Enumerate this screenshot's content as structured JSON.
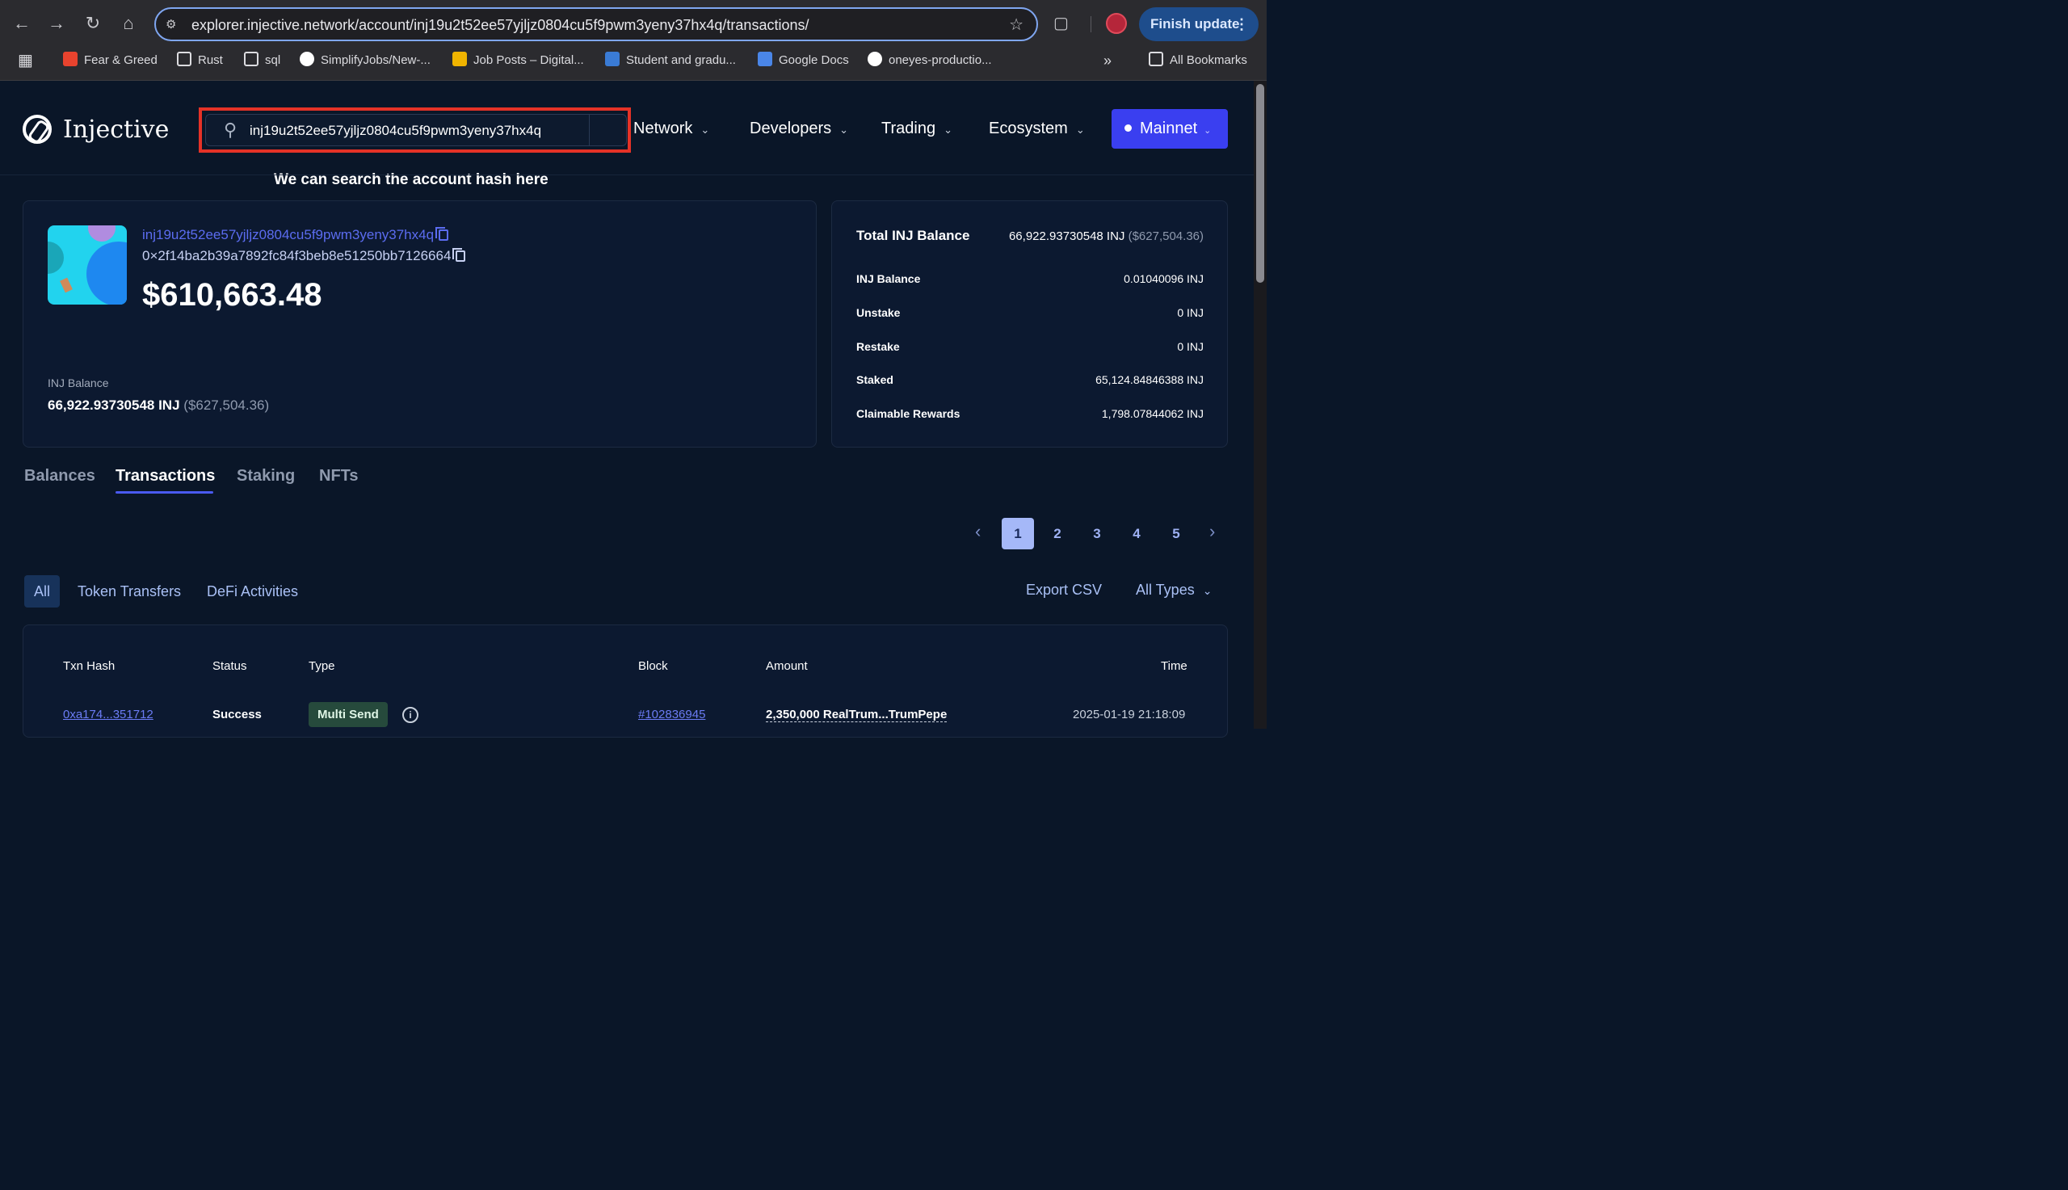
{
  "browser": {
    "url": "explorer.injective.network/account/inj19u2t52ee57yjljz0804cu5f9pwm3yeny37hx4q/transactions/",
    "finish_update": "Finish update",
    "bookmarks": [
      {
        "label": "Fear & Greed",
        "icon": "letter-a-icon",
        "color": "#e8432e"
      },
      {
        "label": "Rust",
        "icon": "folder-icon"
      },
      {
        "label": "sql",
        "icon": "folder-icon"
      },
      {
        "label": "SimplifyJobs/New-...",
        "icon": "github-icon"
      },
      {
        "label": "Job Posts – Digital...",
        "icon": "arrow-logo-icon",
        "color": "#f0b400"
      },
      {
        "label": "Student and gradu...",
        "icon": "nscc-icon",
        "color": "#3a7bd5"
      },
      {
        "label": "Google Docs",
        "icon": "docs-icon",
        "color": "#4a86e8"
      },
      {
        "label": "oneyes-productio...",
        "icon": "vercel-icon"
      }
    ],
    "all_bookmarks": "All Bookmarks"
  },
  "site": {
    "brand": "Injective",
    "search_value": "inj19u2t52ee57yjljz0804cu5f9pwm3yeny37hx4q",
    "annotation": "We can search the account hash here",
    "nav": [
      "Network",
      "Developers",
      "Trading",
      "Ecosystem"
    ],
    "network_button": "Mainnet"
  },
  "account": {
    "address": "inj19u2t52ee57yjljz0804cu5f9pwm3yeny37hx4q",
    "eth_address": "0×2f14ba2b39a7892fc84f3beb8e51250bb7126664",
    "usd_value": "$610,663.48",
    "inj_balance_label": "INJ Balance",
    "inj_balance": "66,922.93730548 INJ",
    "inj_balance_usd": "($627,504.36)"
  },
  "balances": {
    "title": "Total INJ Balance",
    "total": "66,922.93730548 INJ",
    "total_usd": "($627,504.36)",
    "rows": [
      {
        "label": "INJ Balance",
        "value": "0.01040096 INJ"
      },
      {
        "label": "Unstake",
        "value": "0 INJ"
      },
      {
        "label": "Restake",
        "value": "0 INJ"
      },
      {
        "label": "Staked",
        "value": "65,124.84846388 INJ"
      },
      {
        "label": "Claimable Rewards",
        "value": "1,798.07844062 INJ"
      }
    ]
  },
  "tabs": [
    "Balances",
    "Transactions",
    "Staking",
    "NFTs"
  ],
  "active_tab": "Transactions",
  "pagination": {
    "pages": [
      "1",
      "2",
      "3",
      "4",
      "5"
    ],
    "current": "1"
  },
  "filters": {
    "items": [
      "All",
      "Token Transfers",
      "DeFi Activities"
    ],
    "active": "All",
    "export": "Export CSV",
    "type_select": "All Types"
  },
  "table": {
    "headers": [
      "Txn Hash",
      "Status",
      "Type",
      "Block",
      "Amount",
      "Time"
    ],
    "rows": [
      {
        "hash": "0xa174...351712",
        "status": "Success",
        "type": "Multi Send",
        "block": "#102836945",
        "amount": "2,350,000 RealTrum...TrumPepe",
        "time": "2025-01-19 21:18:09"
      }
    ]
  }
}
